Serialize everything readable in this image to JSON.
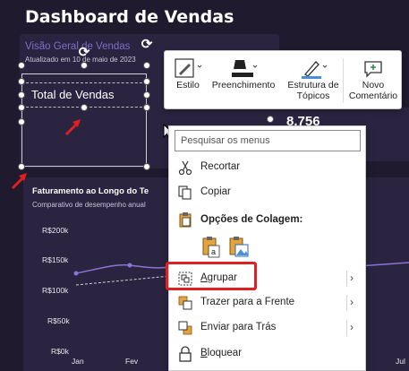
{
  "dashboard": {
    "title": "Dashboard de Vendas",
    "subtitle": "Visão Geral de Vendas",
    "updated": "Atualizado em 10 de maio de 2023",
    "kpi_value": "8.756",
    "chart_title": "Faturamento ao Longo do Te",
    "chart_subtitle": "Comparativo de desempenho anual",
    "y_ticks": [
      "R$200k",
      "R$150k",
      "R$100k",
      "R$50k",
      "R$0k"
    ],
    "x_ticks": [
      "Jan",
      "Fev",
      "Jul"
    ]
  },
  "textbox": {
    "text": "Total de Vendas"
  },
  "toolbar": {
    "items": [
      {
        "label": "Estilo",
        "icon": "shape-style-icon"
      },
      {
        "label": "Preenchimento",
        "icon": "paint-bucket-icon"
      },
      {
        "label": "Estrutura de Tópicos",
        "icon": "shape-outline-icon"
      },
      {
        "label": "Novo Comentário",
        "icon": "new-comment-icon"
      }
    ]
  },
  "menu": {
    "search_placeholder": "Pesquisar os menus",
    "cut": "Recortar",
    "copy": "Copiar",
    "paste_options": "Opções de Colagem:",
    "group": "Agrupar",
    "bring_front": "Trazer para a Frente",
    "send_back": "Enviar para Trás",
    "lock": "Bloquear"
  },
  "colors": {
    "background": "#1f1a2e",
    "card": "#2a2440",
    "accent": "#7f6fc4",
    "highlight": "#e02020",
    "icon_orange": "#e6a23c"
  }
}
